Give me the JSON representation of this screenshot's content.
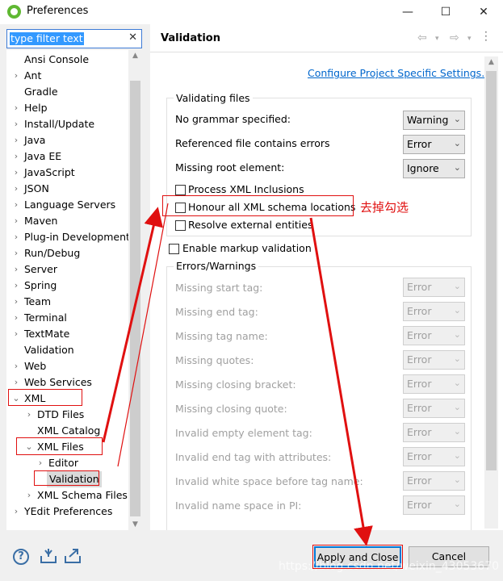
{
  "window": {
    "title": "Preferences",
    "minimize": "—",
    "maximize": "☐",
    "close": "✕"
  },
  "filter": {
    "text": "type filter text",
    "clear": "✕"
  },
  "tree": {
    "items": [
      {
        "label": "Ansi Console",
        "has_children": false,
        "indent": 0
      },
      {
        "label": "Ant",
        "has_children": true,
        "indent": 0
      },
      {
        "label": "Gradle",
        "has_children": false,
        "indent": 0
      },
      {
        "label": "Help",
        "has_children": true,
        "indent": 0
      },
      {
        "label": "Install/Update",
        "has_children": true,
        "indent": 0
      },
      {
        "label": "Java",
        "has_children": true,
        "indent": 0
      },
      {
        "label": "Java EE",
        "has_children": true,
        "indent": 0
      },
      {
        "label": "JavaScript",
        "has_children": true,
        "indent": 0
      },
      {
        "label": "JSON",
        "has_children": true,
        "indent": 0
      },
      {
        "label": "Language Servers",
        "has_children": true,
        "indent": 0
      },
      {
        "label": "Maven",
        "has_children": true,
        "indent": 0
      },
      {
        "label": "Plug-in Development",
        "has_children": true,
        "indent": 0
      },
      {
        "label": "Run/Debug",
        "has_children": true,
        "indent": 0
      },
      {
        "label": "Server",
        "has_children": true,
        "indent": 0
      },
      {
        "label": "Spring",
        "has_children": true,
        "indent": 0
      },
      {
        "label": "Team",
        "has_children": true,
        "indent": 0
      },
      {
        "label": "Terminal",
        "has_children": true,
        "indent": 0
      },
      {
        "label": "TextMate",
        "has_children": true,
        "indent": 0
      },
      {
        "label": "Validation",
        "has_children": false,
        "indent": 0
      },
      {
        "label": "Web",
        "has_children": true,
        "indent": 0
      },
      {
        "label": "Web Services",
        "has_children": true,
        "indent": 0
      },
      {
        "label": "XML",
        "has_children": true,
        "expanded": true,
        "indent": 0
      },
      {
        "label": "DTD Files",
        "has_children": true,
        "indent": 1
      },
      {
        "label": "XML Catalog",
        "has_children": false,
        "indent": 1
      },
      {
        "label": "XML Files",
        "has_children": true,
        "expanded": true,
        "indent": 1
      },
      {
        "label": "Editor",
        "has_children": true,
        "indent": 2
      },
      {
        "label": "Validation",
        "has_children": false,
        "indent": 2,
        "selected": true
      },
      {
        "label": "XML Schema Files",
        "has_children": true,
        "indent": 1
      },
      {
        "label": "YEdit Preferences",
        "has_children": true,
        "indent": 0
      }
    ]
  },
  "page": {
    "title": "Validation",
    "link": "Configure Project Specific Settings...",
    "validating_files": {
      "title": "Validating files",
      "rows": [
        {
          "label": "No grammar specified:",
          "value": "Warning"
        },
        {
          "label": "Referenced file contains errors",
          "value": "Error"
        },
        {
          "label": "Missing root element:",
          "value": "Ignore"
        }
      ],
      "checks": [
        {
          "label": "Process XML Inclusions",
          "checked": false
        },
        {
          "label": "Honour all XML schema locations",
          "checked": false
        },
        {
          "label": "Resolve external entities",
          "checked": false
        }
      ]
    },
    "markup": {
      "label": "Enable markup validation",
      "checked": false
    },
    "errors_warnings": {
      "title": "Errors/Warnings",
      "rows": [
        {
          "label": "Missing start tag:",
          "value": "Error"
        },
        {
          "label": "Missing end tag:",
          "value": "Error"
        },
        {
          "label": "Missing tag name:",
          "value": "Error"
        },
        {
          "label": "Missing quotes:",
          "value": "Error"
        },
        {
          "label": "Missing closing bracket:",
          "value": "Error"
        },
        {
          "label": "Missing closing quote:",
          "value": "Error"
        },
        {
          "label": "Invalid empty element tag:",
          "value": "Error"
        },
        {
          "label": "Invalid end tag with attributes:",
          "value": "Error"
        },
        {
          "label": "Invalid white space before tag name:",
          "value": "Error"
        },
        {
          "label": "Invalid name space in PI:",
          "value": "Error"
        }
      ]
    }
  },
  "annotation": {
    "text": "去掉勾选",
    "color": "#e01010"
  },
  "buttons": {
    "apply_close": "Apply and Close",
    "cancel": "Cancel"
  },
  "watermark": "https://blog.csdn.net/weixin_43053670"
}
